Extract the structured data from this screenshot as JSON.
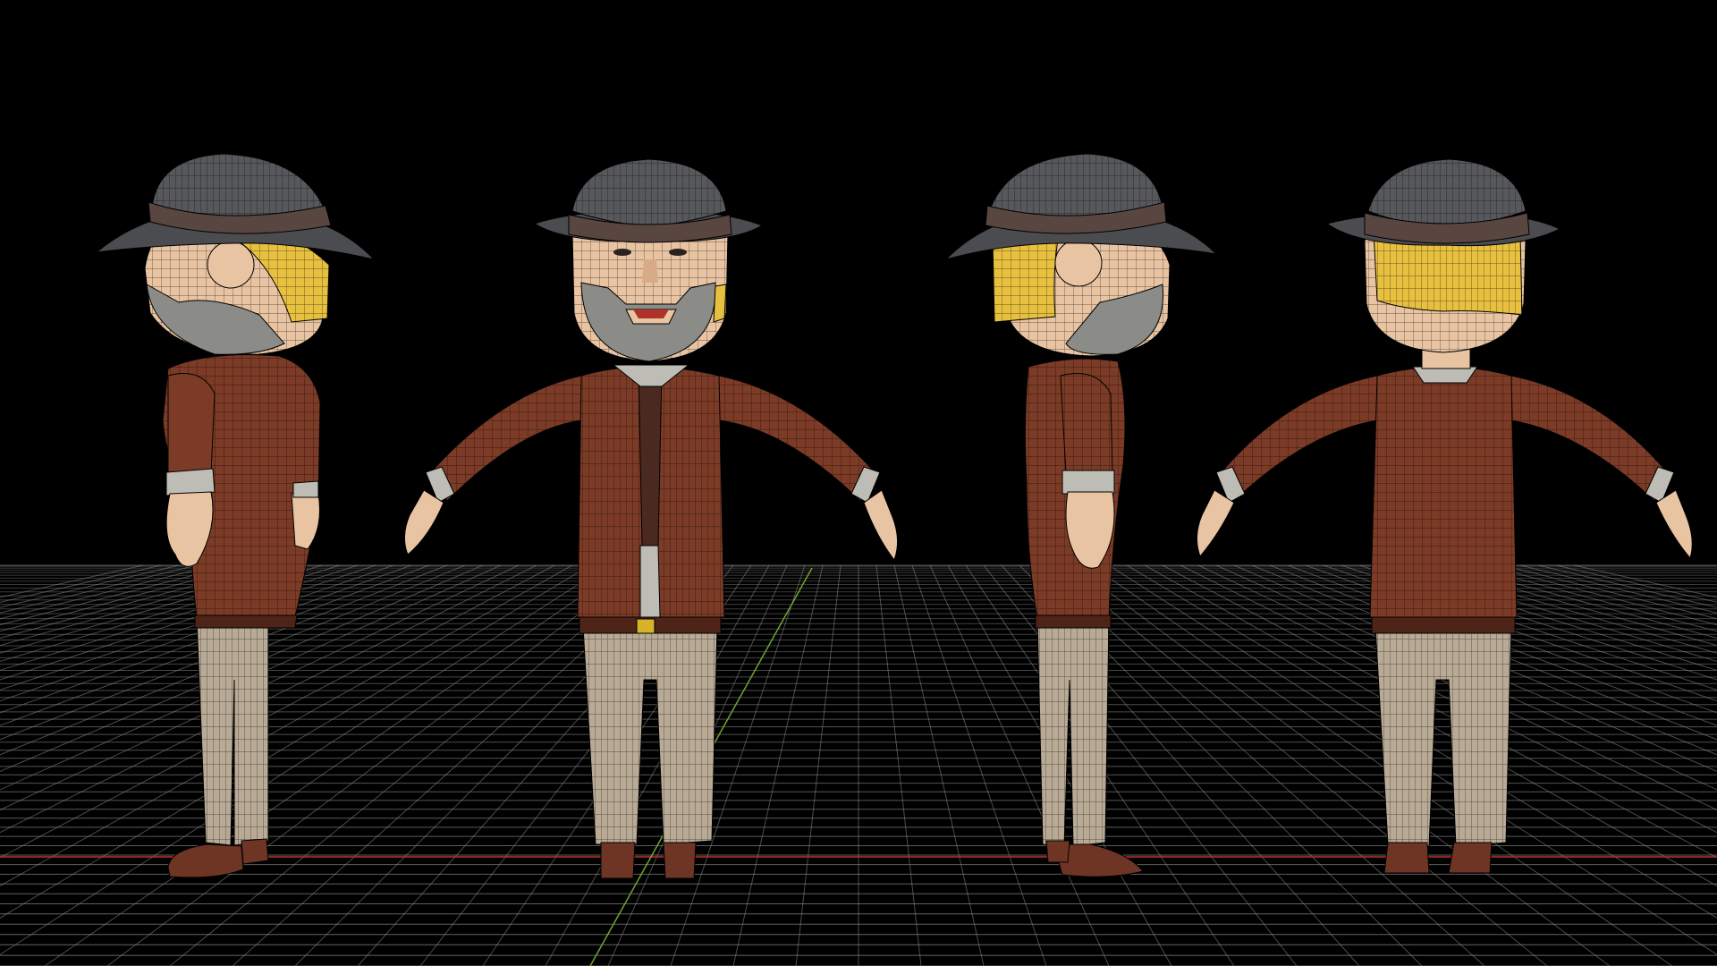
{
  "scene": {
    "background_color": "#000000",
    "grid_color": "#8a8a8a",
    "x_axis_color": "#c0312b",
    "y_axis_color": "#6fa52e",
    "views": [
      "left-side",
      "front",
      "right-side",
      "back"
    ]
  },
  "character": {
    "hat_color": "#56585c",
    "hat_band_color": "#5a4640",
    "hair_color": "#e8c040",
    "skin_color": "#e9c4a2",
    "beard_color": "#8b8b88",
    "jacket_color": "#7c3b26",
    "jacket_dark_color": "#4e2418",
    "cuff_color": "#bdbdb5",
    "pants_color": "#b9aa96",
    "shoe_color": "#6e3525",
    "shirt_color": "#4a2a20",
    "belt_buckle_color": "#d8b228",
    "wireframe_color": "#000000"
  }
}
